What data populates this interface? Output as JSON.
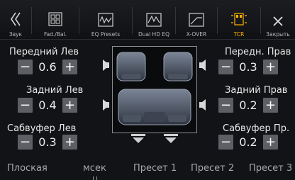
{
  "toolbar": {
    "items": [
      {
        "label": "Звук"
      },
      {
        "label": "Fad./Bal."
      },
      {
        "label": "EQ Presets"
      },
      {
        "label": "Dual HD EQ"
      },
      {
        "label": "X-OVER"
      },
      {
        "label": "TCR"
      },
      {
        "label": "Закрыть"
      }
    ],
    "active_color": "#ffb300",
    "icons": [
      "chevron-double-left-icon",
      "fader-balance-icon",
      "eq-presets-icon",
      "dual-hd-eq-icon",
      "crossover-icon",
      "tcr-icon",
      "close-icon"
    ]
  },
  "channels": {
    "front_left": {
      "name": "Передний Лев",
      "value": "0.6",
      "minus": "−",
      "plus": "+"
    },
    "front_right": {
      "name": "Передн. Прав",
      "value": "0.3",
      "minus": "−",
      "plus": "+"
    },
    "rear_left": {
      "name": "Задний Лев",
      "value": "0.4",
      "minus": "−",
      "plus": "+"
    },
    "rear_right": {
      "name": "Задний Прав",
      "value": "0.2",
      "minus": "−",
      "plus": "+"
    },
    "sub_left": {
      "name": "Сабвуфер Лев",
      "value": "0.3",
      "minus": "−",
      "plus": "+"
    },
    "sub_right": {
      "name": "Сабвуфер Пр.",
      "value": "0.2",
      "minus": "−",
      "plus": "+"
    }
  },
  "presets": [
    {
      "label": "Плоская"
    },
    {
      "label": "мсек"
    },
    {
      "label": "Пресет 1"
    },
    {
      "label": "Пресет 2"
    },
    {
      "label": "Пресет 3"
    }
  ]
}
